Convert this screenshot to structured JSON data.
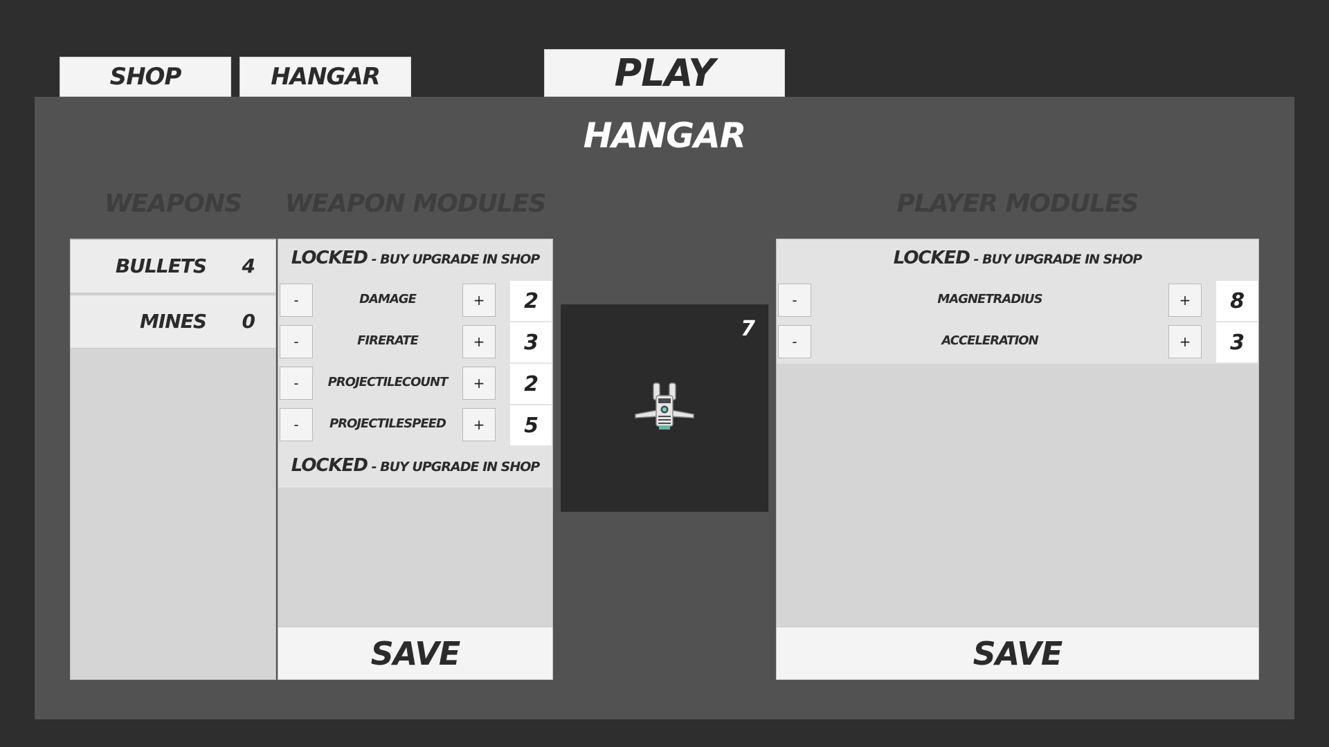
{
  "tabs": {
    "shop": "SHOP",
    "hangar": "HANGAR",
    "play": "PLAY"
  },
  "page_title": "HANGAR",
  "weapons": {
    "title": "WEAPONS",
    "items": [
      {
        "name": "BULLETS",
        "count": "4"
      },
      {
        "name": "MINES",
        "count": "0"
      }
    ]
  },
  "weapon_modules": {
    "title": "WEAPON MODULES",
    "locked_top": {
      "main": "LOCKED",
      "sub": " - BUY UPGRADE IN SHOP"
    },
    "stats": [
      {
        "label": "DAMAGE",
        "value": "2",
        "minus": "-",
        "plus": "+"
      },
      {
        "label": "FIRERATE",
        "value": "3",
        "minus": "-",
        "plus": "+"
      },
      {
        "label": "PROJECTILECOUNT",
        "value": "2",
        "minus": "-",
        "plus": "+"
      },
      {
        "label": "PROJECTILESPEED",
        "value": "5",
        "minus": "-",
        "plus": "+"
      }
    ],
    "locked_bottom": {
      "main": "LOCKED",
      "sub": " - BUY UPGRADE IN SHOP"
    },
    "save_label": "SAVE"
  },
  "preview": {
    "points": "7",
    "icon": "spaceship-icon"
  },
  "player_modules": {
    "title": "PLAYER MODULES",
    "locked_top": {
      "main": "LOCKED",
      "sub": " - BUY UPGRADE IN SHOP"
    },
    "stats": [
      {
        "label": "MAGNETRADIUS",
        "value": "8",
        "minus": "-",
        "plus": "+"
      },
      {
        "label": "ACCELERATION",
        "value": "3",
        "minus": "-",
        "plus": "+"
      }
    ],
    "save_label": "SAVE"
  },
  "colors": {
    "background": "#2e2e2e",
    "panel": "#525252",
    "card": "#d5d5d5",
    "card_active": "#e3e3e3",
    "button": "#f4f4f4",
    "preview_bg": "#2b2b2b",
    "text_dark": "#2b2b2b",
    "text_light": "#ffffff"
  }
}
